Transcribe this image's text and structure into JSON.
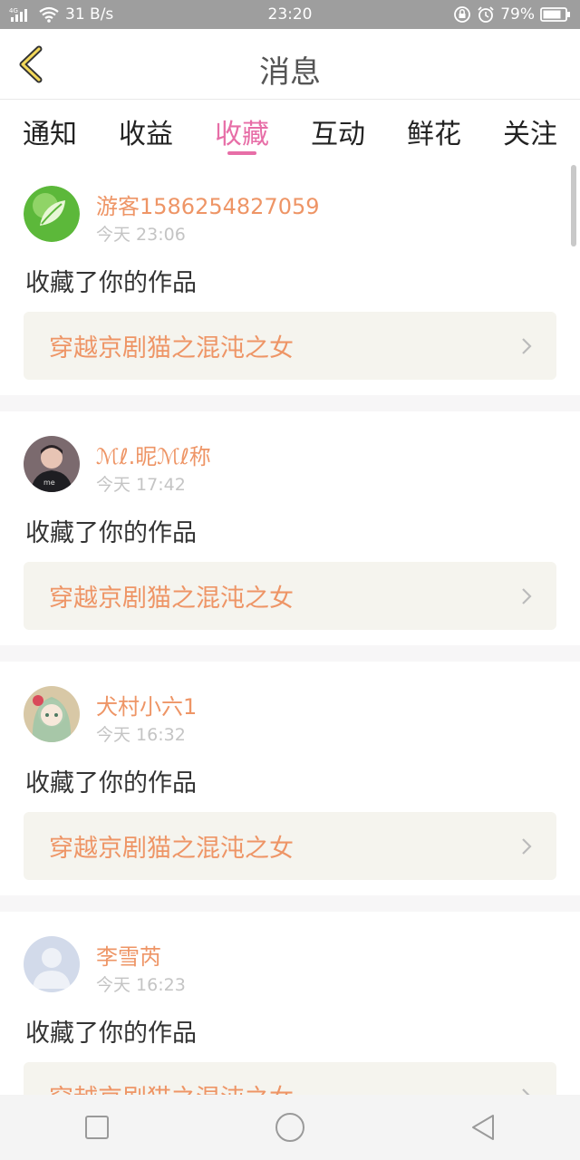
{
  "status_bar": {
    "signal": "4G",
    "speed": "31 B/s",
    "time": "23:20",
    "battery": "79%"
  },
  "header": {
    "title": "消息"
  },
  "tabs": [
    {
      "label": "通知",
      "active": false
    },
    {
      "label": "收益",
      "active": false
    },
    {
      "label": "收藏",
      "active": true
    },
    {
      "label": "互动",
      "active": false
    },
    {
      "label": "鲜花",
      "active": false
    },
    {
      "label": "关注",
      "active": false
    }
  ],
  "messages": [
    {
      "name": "游客1586254827059",
      "time": "今天 23:06",
      "action": "收藏了你的作品",
      "work": "穿越京剧猫之混沌之女",
      "avatar": "leaf-avatar"
    },
    {
      "name": "ℳℓ.昵ℳℓ称",
      "time": "今天 17:42",
      "action": "收藏了你的作品",
      "work": "穿越京剧猫之混沌之女",
      "avatar": "person-avatar"
    },
    {
      "name": "犬村小六1",
      "time": "今天 16:32",
      "action": "收藏了你的作品",
      "work": "穿越京剧猫之混沌之女",
      "avatar": "anime-avatar"
    },
    {
      "name": "李雪芮",
      "time": "今天 16:23",
      "action": "收藏了你的作品",
      "work": "穿越京剧猫之混沌之女",
      "avatar": "default-avatar"
    }
  ],
  "colors": {
    "accent": "#e76ea7",
    "name": "#ee9566",
    "status_bar": "#9e9e9e"
  }
}
